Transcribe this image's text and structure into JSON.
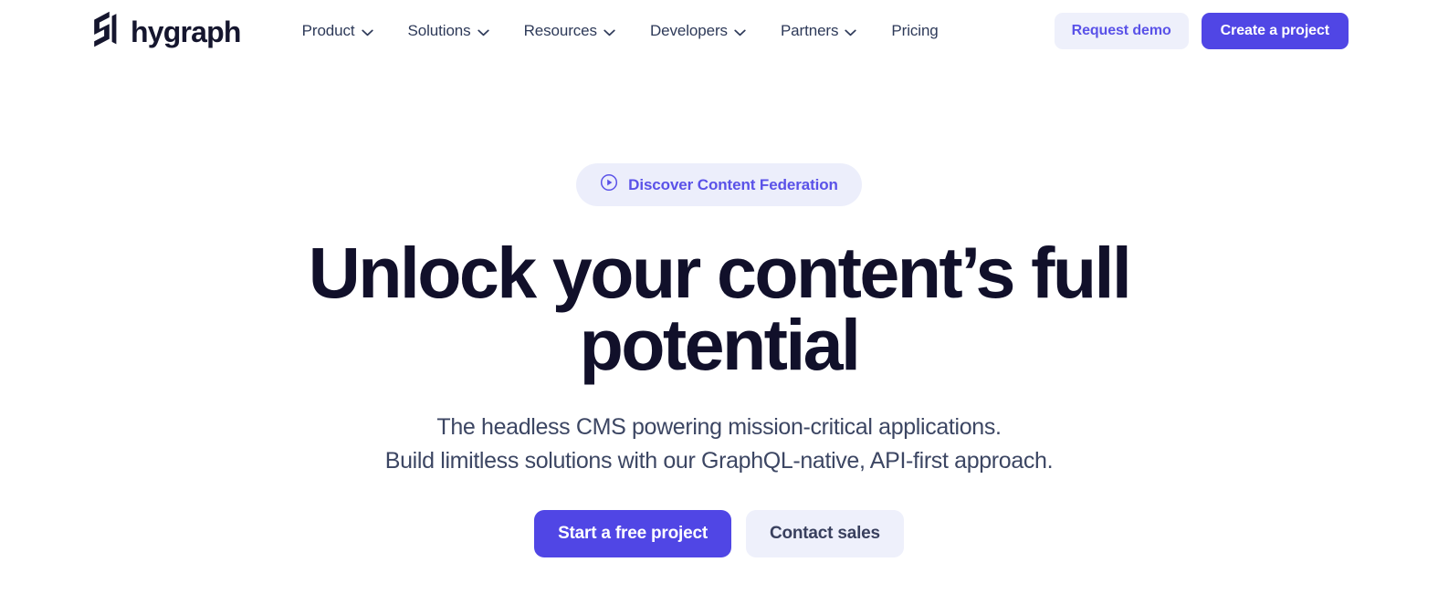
{
  "brand": {
    "name": "hygraph",
    "logo_icon": "hygraph-g-mark-icon"
  },
  "nav": {
    "items": [
      {
        "label": "Product",
        "has_dropdown": true,
        "icon": "chevron-down-icon"
      },
      {
        "label": "Solutions",
        "has_dropdown": true,
        "icon": "chevron-down-icon"
      },
      {
        "label": "Resources",
        "has_dropdown": true,
        "icon": "chevron-down-icon"
      },
      {
        "label": "Developers",
        "has_dropdown": true,
        "icon": "chevron-down-icon"
      },
      {
        "label": "Partners",
        "has_dropdown": true,
        "icon": "chevron-down-icon"
      },
      {
        "label": "Pricing",
        "has_dropdown": false,
        "icon": ""
      }
    ]
  },
  "header_actions": {
    "request_demo_label": "Request demo",
    "create_project_label": "Create a project"
  },
  "hero": {
    "badge": {
      "label": "Discover Content Federation",
      "icon": "play-circle-icon"
    },
    "headline_line1": "Unlock your content’s full",
    "headline_line2": "potential",
    "subtitle_line1": "The headless CMS powering mission-critical applications.",
    "subtitle_line2": "Build limitless solutions with our GraphQL-native, API-first approach.",
    "cta_primary_label": "Start a free project",
    "cta_secondary_label": "Contact sales"
  },
  "colors": {
    "primary": "#5046e5",
    "primary_text": "#5a52e8",
    "light_lavender": "#eef0fb",
    "badge_bg": "#eceefb",
    "headline": "#11102a",
    "nav_text": "#2e3a59",
    "subtitle": "#3c4663",
    "page_bg": "#ffffff"
  }
}
